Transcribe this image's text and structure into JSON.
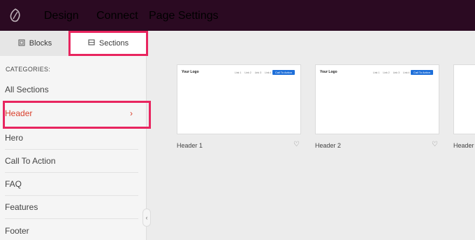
{
  "topbar": {
    "logo_icon": "leaf-logo-icon",
    "nav": [
      "Design",
      "Connect",
      "Page Settings"
    ],
    "bg_color": "#2b0a22"
  },
  "sidebar": {
    "tabs": [
      {
        "label": "Blocks",
        "icon": "blocks-icon"
      },
      {
        "label": "Sections",
        "icon": "sections-icon"
      }
    ],
    "categories_label": "CATEGORIES:",
    "categories": [
      "All Sections",
      "Header",
      "Hero",
      "Call To Action",
      "FAQ",
      "Features",
      "Footer"
    ],
    "active_category": "Header",
    "accent_color": "#d9402c",
    "highlight_color": "#e8255f"
  },
  "main": {
    "cards": [
      {
        "label": "Header 1",
        "logo": "Your Logo",
        "links": [
          "Link 1",
          "Link 2",
          "Link 3",
          "Link 4"
        ],
        "cta": "Call To Action"
      },
      {
        "label": "Header 2",
        "logo": "Your Logo",
        "links": [
          "Link 1",
          "Link 2",
          "Link 3",
          "Link 4"
        ],
        "cta": "Call To Action"
      },
      {
        "label": "Header"
      }
    ]
  }
}
